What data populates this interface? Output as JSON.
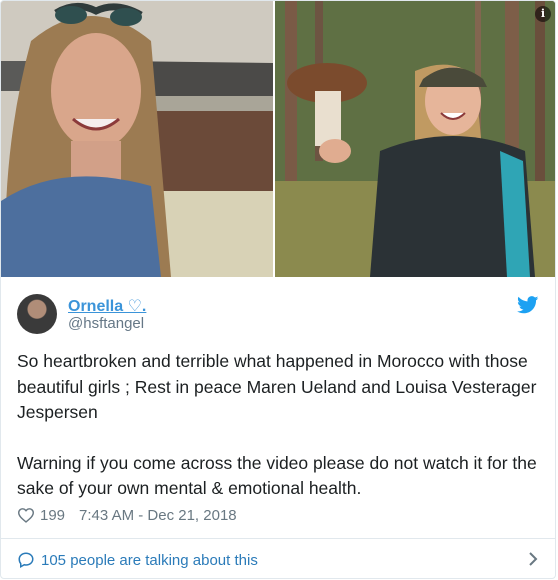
{
  "author": {
    "name": "Ornella ♡.",
    "handle": "@hsftangel"
  },
  "tweet": {
    "paragraphs": [
      "So heartbroken and terrible what happened in Morocco with those beautiful girls ; Rest in peace Maren Ueland and Louisa Vesterager Jespersen",
      "Warning if you come across the video please do not watch it for the sake of your own mental & emotional health."
    ]
  },
  "meta": {
    "likes": "199",
    "timestamp": "7:43 AM - Dec 21, 2018"
  },
  "footer": {
    "talking": "105 people are talking about this"
  },
  "icons": {
    "info": "info-icon",
    "bird": "twitter-bird-icon",
    "heart": "heart-icon",
    "bubble": "speech-bubble-icon",
    "chevron": "chevron-right-icon"
  },
  "colors": {
    "link": "#3b94d9",
    "twitter_blue": "#1da1f2",
    "muted": "#697882"
  }
}
